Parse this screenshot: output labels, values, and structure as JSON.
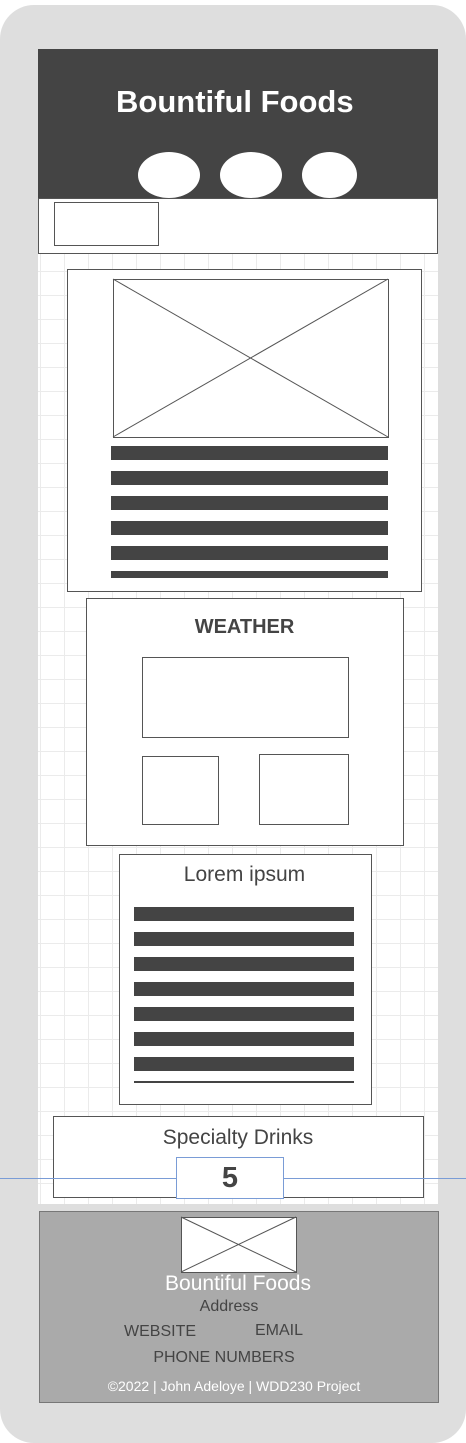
{
  "header": {
    "brand_title": "Bountiful Foods"
  },
  "weather": {
    "heading": "WEATHER"
  },
  "article": {
    "heading": "Lorem ipsum"
  },
  "drinks": {
    "heading": "Specialty Drinks",
    "count": "5"
  },
  "footer": {
    "brand": "Bountiful Foods",
    "address": "Address",
    "website": "WEBSITE",
    "email": "EMAIL",
    "phone": "PHONE NUMBERS",
    "copyright": "©2022 | John Adeloye | WDD230 Project"
  },
  "colors": {
    "dark": "#444444",
    "panel": "#dedede",
    "footer_bg": "#aaaaaa",
    "guide_line": "#7a9cd6"
  }
}
